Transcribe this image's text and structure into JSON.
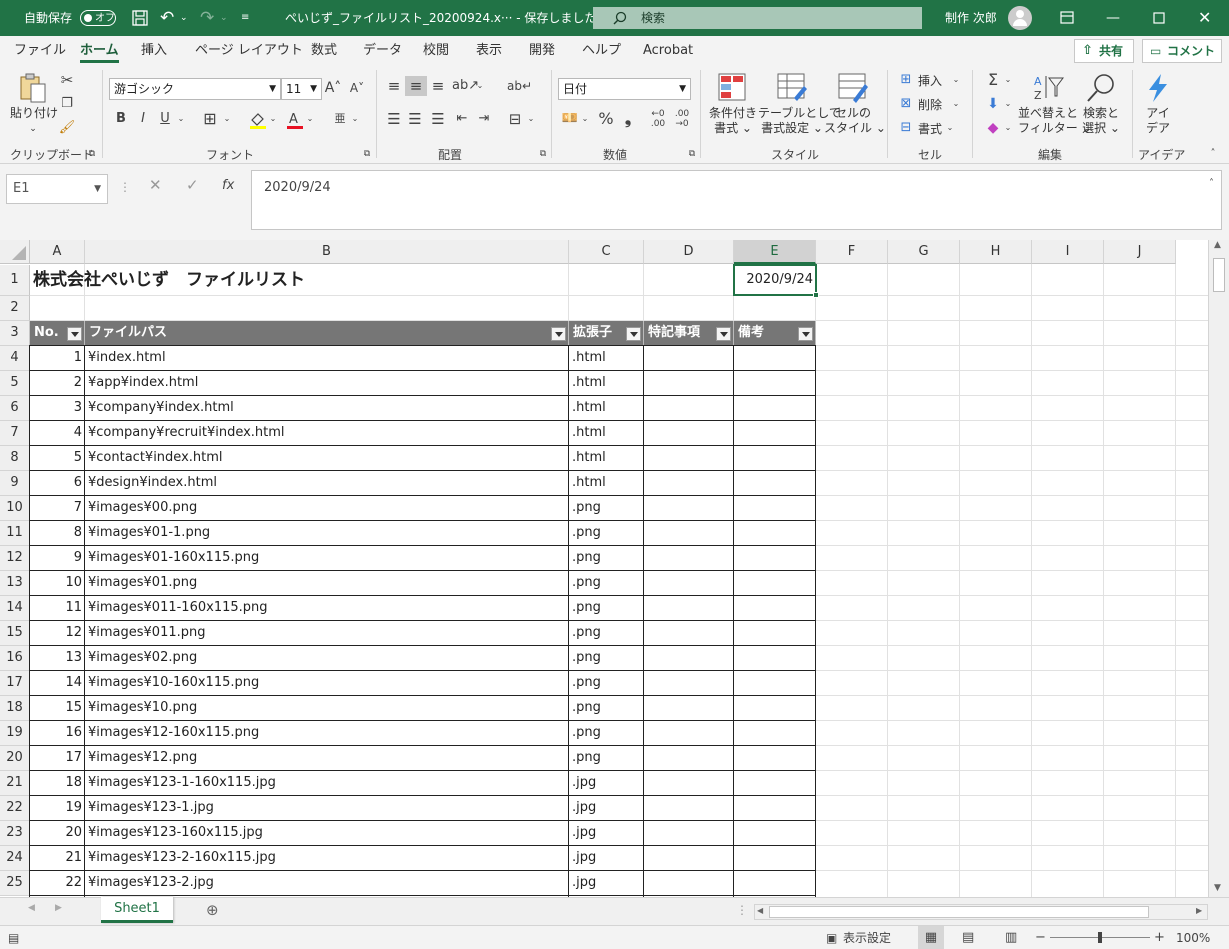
{
  "titlebar": {
    "autosave_label": "自動保存",
    "autosave_state": "オフ",
    "doc_title": "ぺいじず_ファイルリスト_20200924.x··· - 保存しました ⌄",
    "search_placeholder": "検索",
    "user_name": "制作 次郎"
  },
  "menu": {
    "tabs": [
      "ファイル",
      "ホーム",
      "挿入",
      "ページ レイアウト",
      "数式",
      "データ",
      "校閲",
      "表示",
      "開発",
      "ヘルプ",
      "Acrobat"
    ],
    "active_tab": "ホーム",
    "share_label": "共有",
    "comment_label": "コメント"
  },
  "ribbon": {
    "clipboard": {
      "paste_label": "貼り付け",
      "group": "クリップボード"
    },
    "font": {
      "font_name": "游ゴシック",
      "font_size": "11",
      "group": "フォント"
    },
    "alignment": {
      "group": "配置"
    },
    "number": {
      "format": "日付",
      "group": "数値"
    },
    "styles": {
      "conditional_line1": "条件付き",
      "conditional_line2": "書式 ⌄",
      "table_line1": "テーブルとして",
      "table_line2": "書式設定 ⌄",
      "cellstyle_line1": "セルの",
      "cellstyle_line2": "スタイル ⌄",
      "group": "スタイル"
    },
    "cells": {
      "insert": "挿入",
      "delete": "削除",
      "format": "書式",
      "group": "セル"
    },
    "editing": {
      "sort_line1": "並べ替えと",
      "sort_line2": "フィルター ⌄",
      "find_line1": "検索と",
      "find_line2": "選択 ⌄",
      "group": "編集"
    },
    "ideas": {
      "line1": "アイ",
      "line2": "デア",
      "group": "アイデア"
    }
  },
  "formula_bar": {
    "name_box": "E1",
    "formula": "2020/9/24"
  },
  "sheet": {
    "columns": [
      "A",
      "B",
      "C",
      "D",
      "E",
      "F",
      "G",
      "H",
      "I",
      "J"
    ],
    "selected_column": "E",
    "rows": [
      "1",
      "2",
      "3",
      "4",
      "5",
      "6",
      "7",
      "8",
      "9",
      "10",
      "11",
      "12",
      "13",
      "14",
      "15",
      "16",
      "17",
      "18",
      "19",
      "20",
      "21",
      "22",
      "23",
      "24",
      "25"
    ],
    "title": "株式会社ぺいじず　ファイルリスト",
    "date_cell": "2020/9/24",
    "table_headers": [
      "No.",
      "ファイルパス",
      "拡張子",
      "特記事項",
      "備考"
    ],
    "table_rows": [
      {
        "no": "1",
        "path": "¥index.html",
        "ext": ".html"
      },
      {
        "no": "2",
        "path": "¥app¥index.html",
        "ext": ".html"
      },
      {
        "no": "3",
        "path": "¥company¥index.html",
        "ext": ".html"
      },
      {
        "no": "4",
        "path": "¥company¥recruit¥index.html",
        "ext": ".html"
      },
      {
        "no": "5",
        "path": "¥contact¥index.html",
        "ext": ".html"
      },
      {
        "no": "6",
        "path": "¥design¥index.html",
        "ext": ".html"
      },
      {
        "no": "7",
        "path": "¥images¥00.png",
        "ext": ".png"
      },
      {
        "no": "8",
        "path": "¥images¥01-1.png",
        "ext": ".png"
      },
      {
        "no": "9",
        "path": "¥images¥01-160x115.png",
        "ext": ".png"
      },
      {
        "no": "10",
        "path": "¥images¥01.png",
        "ext": ".png"
      },
      {
        "no": "11",
        "path": "¥images¥011-160x115.png",
        "ext": ".png"
      },
      {
        "no": "12",
        "path": "¥images¥011.png",
        "ext": ".png"
      },
      {
        "no": "13",
        "path": "¥images¥02.png",
        "ext": ".png"
      },
      {
        "no": "14",
        "path": "¥images¥10-160x115.png",
        "ext": ".png"
      },
      {
        "no": "15",
        "path": "¥images¥10.png",
        "ext": ".png"
      },
      {
        "no": "16",
        "path": "¥images¥12-160x115.png",
        "ext": ".png"
      },
      {
        "no": "17",
        "path": "¥images¥12.png",
        "ext": ".png"
      },
      {
        "no": "18",
        "path": "¥images¥123-1-160x115.jpg",
        "ext": ".jpg"
      },
      {
        "no": "19",
        "path": "¥images¥123-1.jpg",
        "ext": ".jpg"
      },
      {
        "no": "20",
        "path": "¥images¥123-160x115.jpg",
        "ext": ".jpg"
      },
      {
        "no": "21",
        "path": "¥images¥123-2-160x115.jpg",
        "ext": ".jpg"
      },
      {
        "no": "22",
        "path": "¥images¥123-2.jpg",
        "ext": ".jpg"
      }
    ]
  },
  "sheet_tabs": {
    "active": "Sheet1"
  },
  "statusbar": {
    "display_settings": "表示設定",
    "zoom": "100%"
  },
  "colors": {
    "accent": "#217346",
    "table_header_bg": "#767676"
  }
}
